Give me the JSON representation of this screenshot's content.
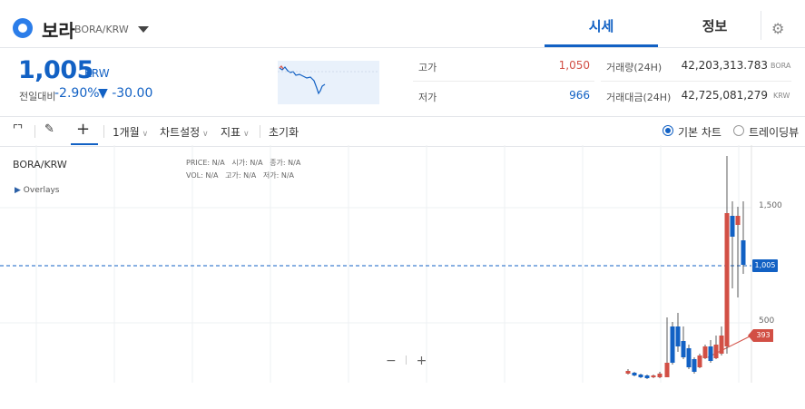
{
  "header": {
    "coin_name": "보라",
    "pair": "BORA/KRW",
    "tabs": [
      "시세",
      "정보"
    ],
    "settings_icon": "gear-icon"
  },
  "ticker": {
    "price": "1,005",
    "unit": "KRW",
    "change_label": "전일대비",
    "change_pct": "-2.90%",
    "change_amt": "▼ -30.00",
    "high_label": "고가",
    "high": "1,050",
    "low_label": "저가",
    "low": "966",
    "volume_label": "거래량(24H)",
    "volume": "42,203,313.783",
    "volume_unit": "BORA",
    "amount_label": "거래대금(24H)",
    "amount": "42,725,081,279",
    "amount_unit": "KRW"
  },
  "toolbar": {
    "period": "1개월",
    "chart_settings": "차트설정",
    "indicators": "지표",
    "reset": "초기화",
    "basic_chart": "기본 차트",
    "tradingview": "트레이딩뷰"
  },
  "chart": {
    "pair": "BORA/KRW",
    "overlays": "Overlays",
    "ohlc_row1": [
      "PRICE:",
      "N/A",
      "시가:",
      "N/A",
      "종가:",
      "N/A"
    ],
    "ohlc_row2": [
      "VOL:",
      "N/A",
      "고가:",
      "N/A",
      "저가:",
      "N/A"
    ],
    "y_tick_1500": "1,500",
    "y_tick_500": "500",
    "current_price_tag": "1,005",
    "low_price_tag": "393",
    "zoom_out": "−",
    "zoom_in": "+"
  },
  "colors": {
    "accent": "#1261c4",
    "up": "#d24f45",
    "down": "#1261c4"
  }
}
